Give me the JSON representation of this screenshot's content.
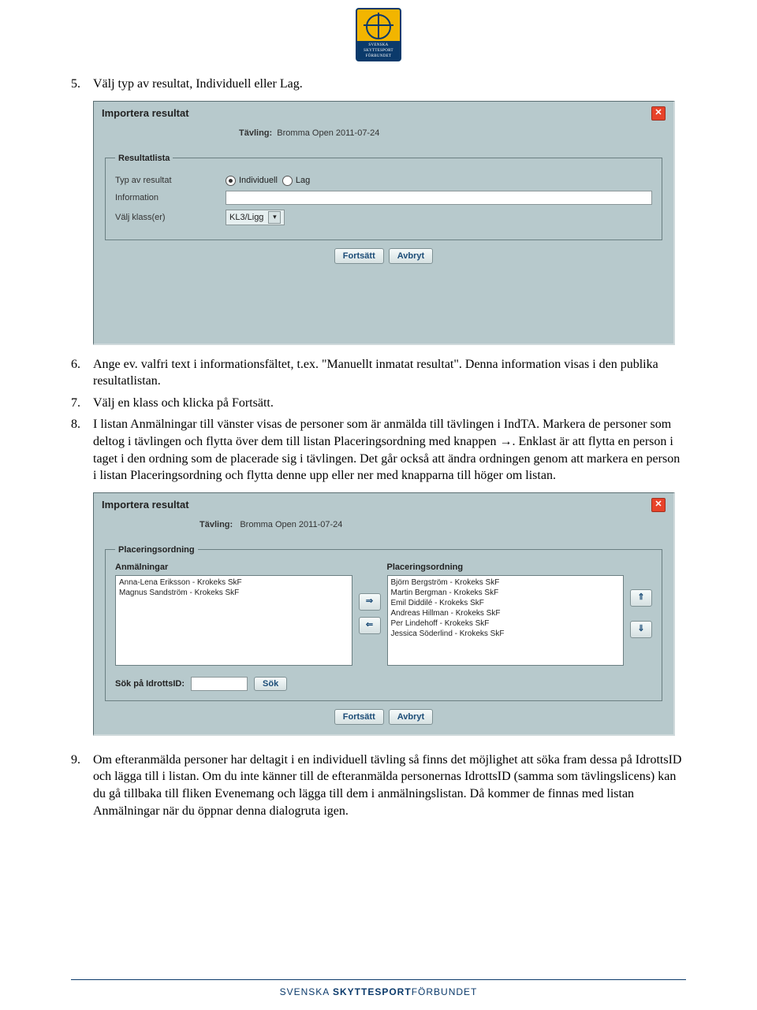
{
  "logo": {
    "line1": "SVENSKA",
    "line2": "SKYTTESPORT",
    "line3": "FÖRBUNDET"
  },
  "steps": {
    "s5": {
      "num": "5.",
      "text": "Välj typ av resultat, Individuell eller Lag."
    },
    "s6": {
      "num": "6.",
      "text": "Ange ev. valfri text i informationsfältet, t.ex. \"Manuellt inmatat resultat\". Denna information visas i den publika resultatlistan."
    },
    "s7": {
      "num": "7.",
      "text": "Välj en klass och klicka på Fortsätt."
    },
    "s8": {
      "num": "8.",
      "text": "I listan Anmälningar till vänster visas de personer som är anmälda till tävlingen i IndTA. Markera de personer som deltog i tävlingen och flytta över dem till listan Placeringsordning med knappen →. Enklast är att flytta en person i taget i den ordning som de placerade sig i tävlingen. Det går också att ändra ordningen genom att markera en person i listan Placeringsordning och flytta denne upp eller ner med knapparna till höger om listan."
    },
    "s9": {
      "num": "9.",
      "text": "Om efteranmälda personer har deltagit i en individuell tävling så finns det möjlighet att söka fram dessa på IdrottsID och lägga till i listan. Om du inte känner till de efteranmälda personernas IdrottsID (samma som tävlingslicens) kan du gå tillbaka till fliken Evenemang och lägga till dem i anmälningslistan. Då kommer de finnas med listan Anmälningar när du öppnar denna dialogruta igen."
    }
  },
  "dialog1": {
    "title": "Importera resultat",
    "tavling_label": "Tävling:",
    "tavling_value": "Bromma Open 2011-07-24",
    "legend": "Resultatlista",
    "row_type_label": "Typ av resultat",
    "radio_individuell": "Individuell",
    "radio_lag": "Lag",
    "row_info_label": "Information",
    "row_class_label": "Välj klass(er)",
    "class_value": "KL3/Ligg",
    "btn_continue": "Fortsätt",
    "btn_cancel": "Avbryt"
  },
  "dialog2": {
    "title": "Importera resultat",
    "tavling_label": "Tävling:",
    "tavling_value": "Bromma Open 2011-07-24",
    "legend": "Placeringsordning",
    "col_left_title": "Anmälningar",
    "col_right_title": "Placeringsordning",
    "left_items": [
      "Anna-Lena Eriksson - Krokeks SkF",
      "Magnus Sandström - Krokeks SkF"
    ],
    "right_items": [
      "Björn Bergström - Krokeks SkF",
      "Martin Bergman - Krokeks SkF",
      "Emil Diddilé - Krokeks SkF",
      "Andreas Hillman - Krokeks SkF",
      "Per Lindehoff - Krokeks SkF",
      "Jessica Söderlind - Krokeks SkF"
    ],
    "btn_right": "⇒",
    "btn_left": "⇐",
    "btn_up": "⇑",
    "btn_down": "⇓",
    "search_label": "Sök på IdrottsID:",
    "search_btn": "Sök",
    "btn_continue": "Fortsätt",
    "btn_cancel": "Avbryt"
  },
  "footer": {
    "brand_light": "SVENSKA ",
    "brand_bold": "SKYTTESPORT",
    "brand_tail": "FÖRBUNDET"
  }
}
